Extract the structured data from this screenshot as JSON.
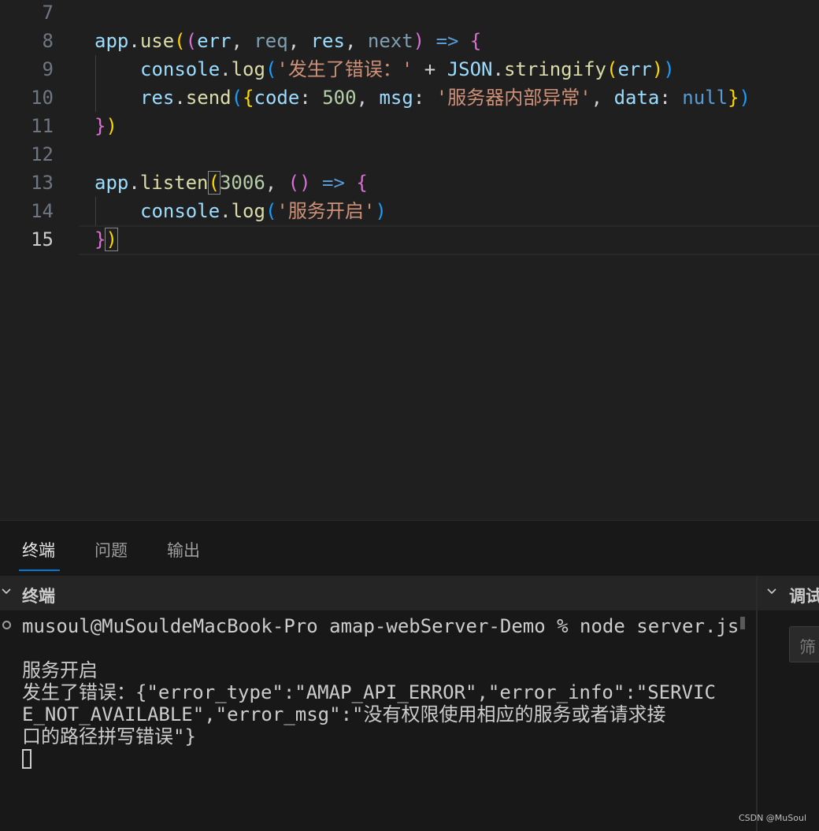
{
  "editor": {
    "active_line": "15",
    "lines": [
      {
        "num": "7"
      },
      {
        "num": "8",
        "tokens": [
          "app",
          ".",
          "use",
          "(",
          "(",
          "err",
          ", ",
          "req",
          ", ",
          "res",
          ", ",
          "next",
          ")",
          " => ",
          "{"
        ]
      },
      {
        "num": "9",
        "tokens": [
          "console",
          ".",
          "log",
          "(",
          "'发生了错误：'",
          " + ",
          "JSON",
          ".",
          "stringify",
          "(",
          "err",
          ")",
          ")"
        ]
      },
      {
        "num": "10",
        "tokens": [
          "res",
          ".",
          "send",
          "(",
          "{",
          "code",
          ": ",
          "500",
          ", ",
          "msg",
          ": ",
          "'服务器内部异常'",
          ", ",
          "data",
          ": ",
          "null",
          "}",
          ")"
        ]
      },
      {
        "num": "11",
        "tokens": [
          "}",
          ")"
        ]
      },
      {
        "num": "12"
      },
      {
        "num": "13",
        "tokens": [
          "app",
          ".",
          "listen",
          "(",
          "3006",
          ", ",
          "(",
          ")",
          " => ",
          "{"
        ]
      },
      {
        "num": "14",
        "tokens": [
          "console",
          ".",
          "log",
          "(",
          "'服务开启'",
          ")"
        ]
      },
      {
        "num": "15",
        "tokens": [
          "}",
          ")"
        ]
      }
    ]
  },
  "panel": {
    "tabs": [
      "终端",
      "问题",
      "输出"
    ],
    "active_tab": "终端",
    "terminal_header": "终端",
    "side_header": "调试",
    "filter_placeholder": "筛",
    "terminal": {
      "prompt": "musoul@MuSouldeMacBook-Pro amap-webServer-Demo % node server.js",
      "output": [
        "",
        "服务开启",
        "发生了错误：{\"error_type\":\"AMAP_API_ERROR\",\"error_info\":\"SERVIC",
        "E_NOT_AVAILABLE\",\"error_msg\":\"没有权限使用相应的服务或者请求接",
        "口的路径拼写错误\"}"
      ]
    }
  },
  "icons": [
    "chevron-down-icon",
    "circle-status-icon"
  ],
  "colors": {
    "editor_bg": "#1f1f1f",
    "panel_bg": "#181818",
    "accent": "#0078d4",
    "string": "#ce9178",
    "variable": "#9cdcfe",
    "function": "#dcdcaa",
    "number": "#b5cea8",
    "keyword": "#569cd6"
  },
  "watermark": "CSDN @MuSoul"
}
